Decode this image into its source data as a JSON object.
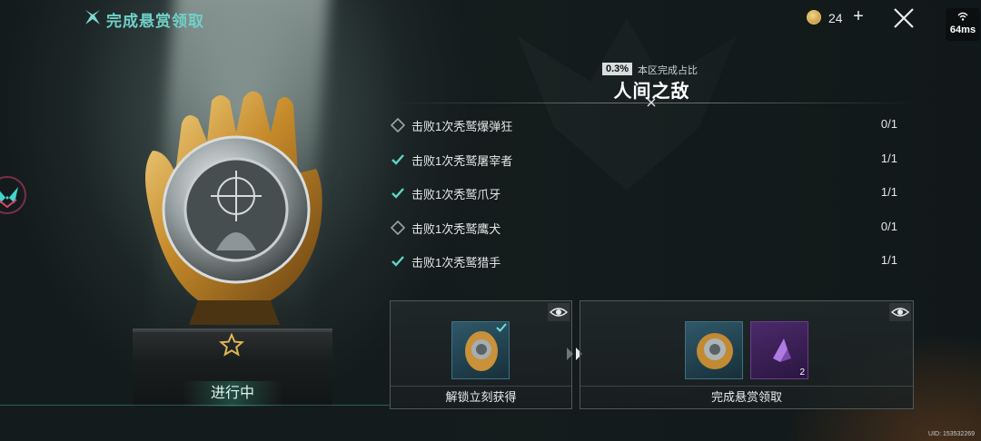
{
  "header": {
    "title": "完成悬赏领取",
    "currency_count": "24",
    "plus_label": "+",
    "network_ping": "64ms"
  },
  "trophy": {
    "status": "进行中"
  },
  "bounty": {
    "completion_percent": "0.3%",
    "completion_label": "本区完成占比",
    "name": "人间之敌"
  },
  "tasks": [
    {
      "text": "击败1次秃鹫爆弹狂",
      "progress": "0/1",
      "completed": false
    },
    {
      "text": "击败1次秃鹫屠宰者",
      "progress": "1/1",
      "completed": true
    },
    {
      "text": "击败1次秃鹫爪牙",
      "progress": "1/1",
      "completed": true
    },
    {
      "text": "击败1次秃鹫鹰犬",
      "progress": "0/1",
      "completed": false
    },
    {
      "text": "击败1次秃鹫猎手",
      "progress": "1/1",
      "completed": true
    }
  ],
  "rewards": {
    "unlock_label": "解锁立刻获得",
    "complete_label": "完成悬赏领取",
    "crystal_count": "2"
  },
  "footer": {
    "uid": "UID: 153532269"
  },
  "colors": {
    "accent": "#6fd0c8",
    "check": "#5fd4c4",
    "gold": "#d9a646",
    "panel_border": "#50595a"
  }
}
